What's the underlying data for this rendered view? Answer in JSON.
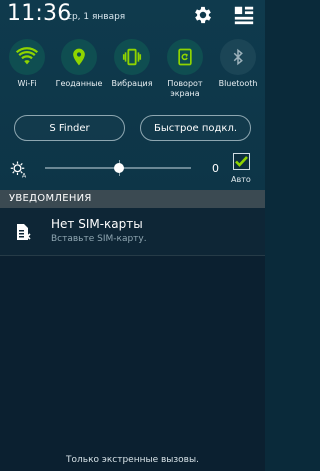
{
  "status_bar": {
    "time": "11:36",
    "date": "ср, 1 января"
  },
  "quick_toggles": [
    {
      "label": "Wi-Fi",
      "icon": "wifi-icon",
      "active": true
    },
    {
      "label": "Геоданные",
      "icon": "location-icon",
      "active": true
    },
    {
      "label": "Вибрация",
      "icon": "vibration-icon",
      "active": true
    },
    {
      "label": "Поворот\nэкрана",
      "icon": "rotate-icon",
      "active": true
    },
    {
      "label": "Bluetooth",
      "icon": "bluetooth-icon",
      "active": false
    }
  ],
  "buttons": {
    "s_finder": "S Finder",
    "quick_connect": "Быстрое подкл."
  },
  "brightness": {
    "value": "0",
    "auto_label": "Авто",
    "auto_checked": true,
    "level": 0.5
  },
  "notifications": {
    "header": "УВЕДОМЛЕНИЯ",
    "items": [
      {
        "title": "Нет SIM-карты",
        "text": "Вставьте SIM-карту.",
        "icon": "sim-card-icon"
      }
    ]
  },
  "footer": {
    "text": "Только экстренные вызовы."
  },
  "colors": {
    "accent_green": "#8fd400",
    "header_bg": "#0f3a4d",
    "section_header_bg": "#3b4a52"
  }
}
